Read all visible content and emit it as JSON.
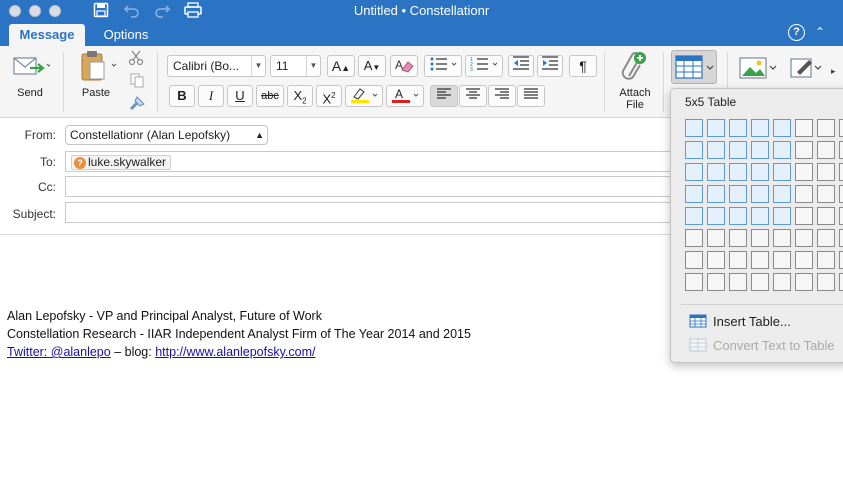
{
  "window": {
    "title": "Untitled • Constellationr"
  },
  "tabs": [
    {
      "label": "Message",
      "active": true
    },
    {
      "label": "Options",
      "active": false
    }
  ],
  "ribbon": {
    "send_label": "Send",
    "paste_label": "Paste",
    "font_name": "Calibri (Bo...",
    "font_size": "11",
    "attach_label_line1": "Attach",
    "attach_label_line2": "File",
    "bold": "B",
    "italic": "I",
    "underline": "U",
    "strikethrough": "abc",
    "pilcrow": "¶"
  },
  "header": {
    "from_label": "From:",
    "from_value": "Constellationr (Alan Lepofsky)",
    "to_label": "To:",
    "to_recipient": "luke.skywalker",
    "cc_label": "Cc:",
    "subject_label": "Subject:"
  },
  "signature": {
    "line1": "Alan Lepofsky - VP and Principal Analyst, Future of Work",
    "line2": "Constellation Research - IIAR Independent Analyst Firm of The Year 2014 and 2015",
    "twitter_link": "Twitter: @alanlepo",
    "blog_prefix": " – blog: ",
    "blog_link": "http://www.alanlepofsky.com/"
  },
  "table_menu": {
    "title": "5x5 Table",
    "insert_table": "Insert Table...",
    "convert_text": "Convert Text to Table",
    "selected_rows": 5,
    "selected_cols": 5
  },
  "colors": {
    "accent": "#2b74c4",
    "highlight": "#ffe600",
    "font_color": "#e0201a",
    "link": "#1a0dab"
  }
}
